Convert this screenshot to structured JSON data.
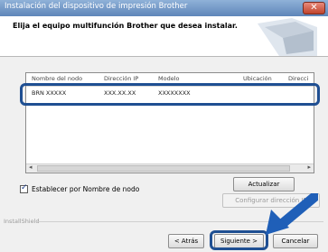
{
  "window": {
    "title": "Instalación del dispositivo de impresión Brother",
    "close_icon": "close-icon"
  },
  "header": {
    "instruction": "Elija el equipo multifunción Brother que desea instalar."
  },
  "device_list": {
    "columns": [
      "Nombre del nodo",
      "Dirección IP",
      "Modelo",
      "Ubicación",
      "Direcci"
    ],
    "rows": [
      {
        "node_name": "BRN XXXXX",
        "ip_address": "XXX.XX.XX",
        "model": "XXXXXXXX",
        "location": "",
        "direction": ""
      }
    ]
  },
  "buttons": {
    "refresh": "Actualizar",
    "configure_ip": "Configurar dirección IP",
    "back": "< Atrás",
    "next": "Siguiente >",
    "cancel": "Cancelar"
  },
  "options": {
    "set_by_node_name": {
      "label": "Establecer por Nombre de nodo",
      "checked": true
    }
  },
  "footer": {
    "brand": "InstallShield"
  },
  "colors": {
    "highlight": "#1f4f92",
    "titlebar": "#6a91c2"
  }
}
